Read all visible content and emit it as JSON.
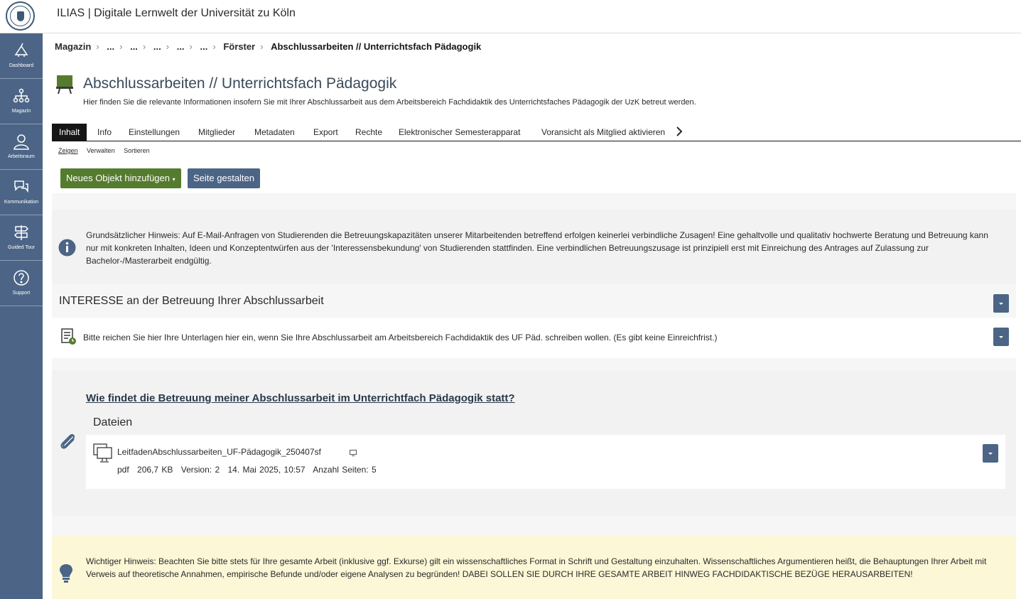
{
  "header": {
    "title": "ILIAS | Digitale Lernwelt der Universität zu Köln",
    "colors": {
      "sidebar": "#4c6586",
      "primary_button": "#557b2e",
      "secondary_button": "#4c6586"
    }
  },
  "sidebar": {
    "items": [
      {
        "label": "Dashboard",
        "icon": "dashboard-icon"
      },
      {
        "label": "Magazin",
        "icon": "sitemap-icon"
      },
      {
        "label": "Arbeitsraum",
        "icon": "user-icon"
      },
      {
        "label": "Kommunikation",
        "icon": "chat-icon"
      },
      {
        "label": "Guided Tour",
        "icon": "signpost-icon"
      },
      {
        "label": "Support",
        "icon": "help-icon"
      }
    ]
  },
  "breadcrumb": {
    "items": [
      "Magazin",
      "...",
      "...",
      "...",
      "...",
      "...",
      "Förster"
    ],
    "current": "Abschlussarbeiten // Unterrichtsfach Pädagogik"
  },
  "page": {
    "title": "Abschlussarbeiten // Unterrichtsfach Pädagogik",
    "description": "Hier finden Sie die relevante Informationen insofern Sie mit Ihrer Abschlussarbeit aus dem Arbeitsbereich Fachdidaktik des Unterrichtsfaches Pädagogik der UzK betreut werden."
  },
  "tabs": [
    "Inhalt",
    "Info",
    "Einstellungen",
    "Mitglieder",
    "Metadaten",
    "Export",
    "Rechte",
    "Elektronischer Semesterapparat",
    "Voransicht als Mitglied aktivieren"
  ],
  "subtabs": [
    "Zeigen",
    "Verwalten",
    "Sortieren"
  ],
  "toolbar": {
    "add_label": "Neues Objekt hinzufügen",
    "design_label": "Seite gestalten"
  },
  "info_panel": {
    "text": "Grundsätzlicher Hinweis: Auf E-Mail-Anfragen von Studierenden die Betreuungskapazitäten unserer Mitarbeitenden betreffend erfolgen keinerlei verbindliche Zusagen!  Eine gehaltvolle und qualitativ hochwerte Beratung und Betreuung kann nur mit konkreten Inhalten, Ideen und Konzeptentwürfen aus der 'Interessensbekundung' von Studierenden stattfinden. Eine verbindlichen Betreuungszusage ist prinzipiell erst mit Einreichung des Antrages auf Zulassung zur Bachelor-/Masterarbeit endgültig."
  },
  "section": {
    "title": "INTERESSE an der Betreuung Ihrer Abschlussarbeit",
    "item_text": "Bitte reichen Sie hier Ihre Unterlagen hier ein, wenn Sie Ihre Abschlussarbeit am Arbeitsbereich Fachdidaktik des UF Päd. schreiben wollen. (Es gibt keine Einreichfrist.)"
  },
  "files_block": {
    "heading": "Wie findet die Betreuung meiner Abschlussarbeit im Unterrichtfach Pädagogik statt?",
    "files_title": "Dateien",
    "file": {
      "name": "LeitfadenAbschlussarbeiten_UF-Pädagogik_250407sf",
      "type": "pdf",
      "size": "206,7 KB",
      "version": "Version: 2",
      "date": "14. Mai 2025, 10:57",
      "pages": "Anzahl Seiten: 5"
    }
  },
  "warn_panel": {
    "text": "Wichtiger Hinweis: Beachten Sie bitte stets für Ihre gesamte Arbeit (inklusive ggf. Exkurse) gilt ein wissenschaftliches Format in Schrift und Gestaltung einzuhalten. Wissenschaftliches Argumentieren heißt, die Behauptungen Ihrer Arbeit mit Verweis auf theoretische Annahmen, empirische Befunde und/oder eigene Analysen zu begründen! DABEI SOLLEN SIE DURCH IHRE GESAMTE ARBEIT HINWEG FACHDIDAKTISCHE BEZÜGE HERAUSARBEITEN!"
  }
}
